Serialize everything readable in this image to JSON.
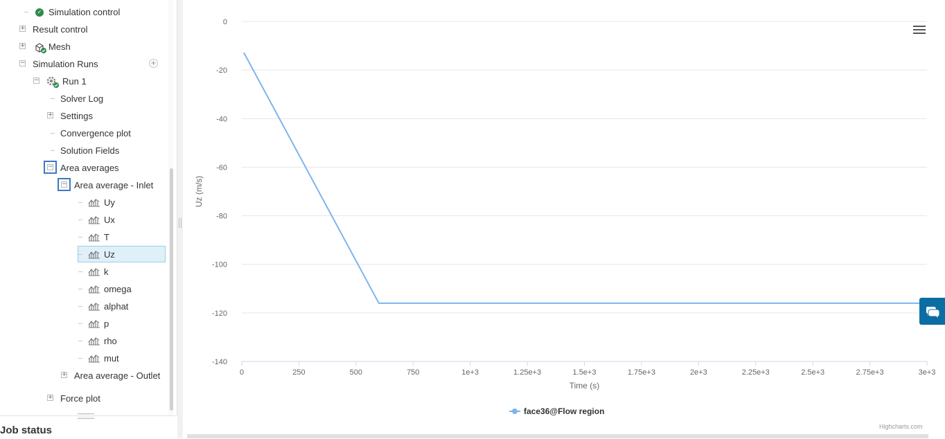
{
  "tree": {
    "items": [
      {
        "label": "Simulation control",
        "icon": "check-icon",
        "toggle": ""
      },
      {
        "label": "Result control",
        "icon": "",
        "toggle": "+"
      },
      {
        "label": "Mesh",
        "icon": "mesh-icon",
        "toggle": "+"
      },
      {
        "label": "Simulation Runs",
        "icon": "",
        "toggle": "−"
      },
      {
        "label": "Run 1",
        "icon": "gear-icon",
        "toggle": "−"
      },
      {
        "label": "Solver Log",
        "icon": "",
        "toggle": ""
      },
      {
        "label": "Settings",
        "icon": "",
        "toggle": "+"
      },
      {
        "label": "Convergence plot",
        "icon": "",
        "toggle": ""
      },
      {
        "label": "Solution Fields",
        "icon": "",
        "toggle": ""
      },
      {
        "label": "Area averages",
        "icon": "",
        "toggle": "−"
      },
      {
        "label": "Area average - Inlet",
        "icon": "",
        "toggle": "−"
      },
      {
        "label": "Uy",
        "icon": "chart-icon",
        "toggle": ""
      },
      {
        "label": "Ux",
        "icon": "chart-icon",
        "toggle": ""
      },
      {
        "label": "T",
        "icon": "chart-icon",
        "toggle": ""
      },
      {
        "label": "Uz",
        "icon": "chart-icon",
        "toggle": "",
        "selected": true
      },
      {
        "label": "k",
        "icon": "chart-icon",
        "toggle": ""
      },
      {
        "label": "omega",
        "icon": "chart-icon",
        "toggle": ""
      },
      {
        "label": "alphat",
        "icon": "chart-icon",
        "toggle": ""
      },
      {
        "label": "p",
        "icon": "chart-icon",
        "toggle": ""
      },
      {
        "label": "rho",
        "icon": "chart-icon",
        "toggle": ""
      },
      {
        "label": "mut",
        "icon": "chart-icon",
        "toggle": ""
      },
      {
        "label": "Area average - Outlet",
        "icon": "",
        "toggle": "+"
      },
      {
        "label": "Force plot",
        "icon": "",
        "toggle": "+"
      }
    ],
    "add_button": "+"
  },
  "job_status": {
    "title": "Job status"
  },
  "chart": {
    "credits": "Highcharts.com"
  },
  "colors": {
    "series": "#7cb5ec",
    "accent": "#0b6ea3",
    "highlight": "#3d78c4",
    "check": "#2e8b4a"
  },
  "chart_data": {
    "type": "line",
    "title": "",
    "xlabel": "Time (s)",
    "ylabel": "Uz (m/s)",
    "xlim": [
      0,
      3000
    ],
    "ylim": [
      -140,
      0
    ],
    "x_ticks": [
      {
        "v": 0,
        "label": "0"
      },
      {
        "v": 250,
        "label": "250"
      },
      {
        "v": 500,
        "label": "500"
      },
      {
        "v": 750,
        "label": "750"
      },
      {
        "v": 1000,
        "label": "1e+3"
      },
      {
        "v": 1250,
        "label": "1.25e+3"
      },
      {
        "v": 1500,
        "label": "1.5e+3"
      },
      {
        "v": 1750,
        "label": "1.75e+3"
      },
      {
        "v": 2000,
        "label": "2e+3"
      },
      {
        "v": 2250,
        "label": "2.25e+3"
      },
      {
        "v": 2500,
        "label": "2.5e+3"
      },
      {
        "v": 2750,
        "label": "2.75e+3"
      },
      {
        "v": 3000,
        "label": "3e+3"
      }
    ],
    "y_ticks": [
      {
        "v": 0,
        "label": "0"
      },
      {
        "v": -20,
        "label": "-20"
      },
      {
        "v": -40,
        "label": "-40"
      },
      {
        "v": -60,
        "label": "-60"
      },
      {
        "v": -80,
        "label": "-80"
      },
      {
        "v": -100,
        "label": "-100"
      },
      {
        "v": -120,
        "label": "-120"
      },
      {
        "v": -140,
        "label": "-140"
      }
    ],
    "grid": true,
    "legend_position": "bottom-center",
    "series": [
      {
        "name": "face36@Flow region",
        "x": [
          10,
          600,
          3000
        ],
        "y": [
          -13,
          -116,
          -116
        ]
      }
    ]
  }
}
